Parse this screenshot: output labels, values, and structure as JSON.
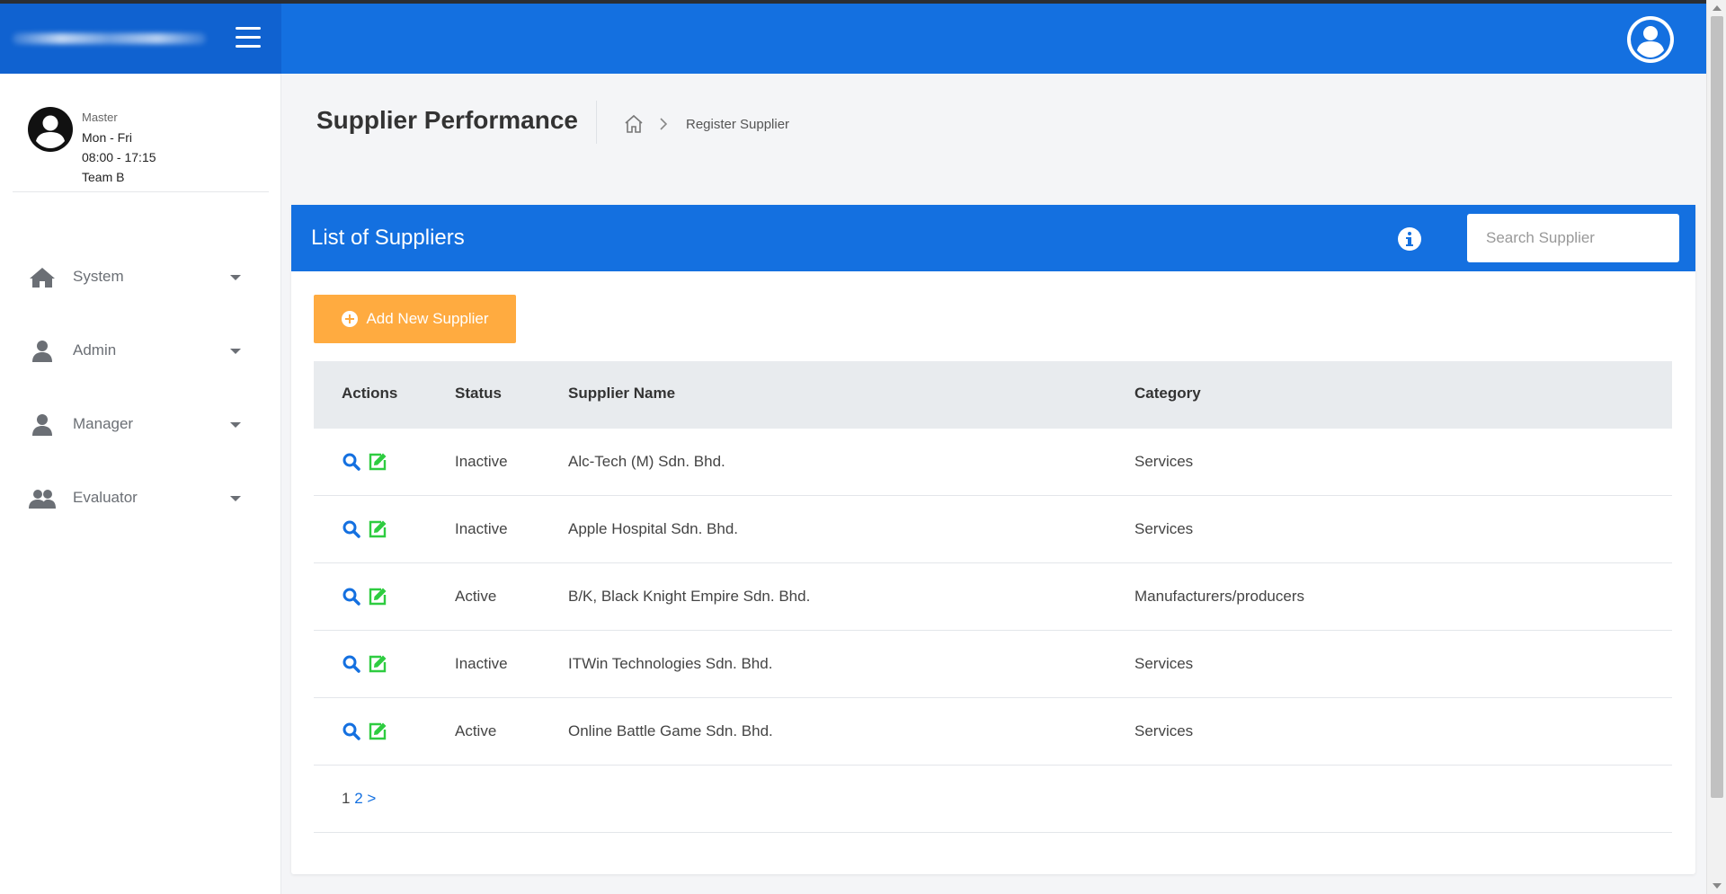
{
  "sidebar": {
    "profile": {
      "role": "Master",
      "days": "Mon - Fri",
      "hours": "08:00 - 17:15",
      "team": "Team B"
    },
    "items": [
      {
        "label": "System",
        "icon": "home-icon"
      },
      {
        "label": "Admin",
        "icon": "user-icon"
      },
      {
        "label": "Manager",
        "icon": "user-icon"
      },
      {
        "label": "Evaluator",
        "icon": "users-icon"
      }
    ]
  },
  "page": {
    "title": "Supplier Performance",
    "breadcrumb_current": "Register Supplier"
  },
  "card": {
    "title": "List of Suppliers",
    "search_placeholder": "Search Supplier",
    "add_button": "Add New Supplier"
  },
  "table": {
    "headers": {
      "actions": "Actions",
      "status": "Status",
      "name": "Supplier Name",
      "category": "Category"
    },
    "rows": [
      {
        "status": "Inactive",
        "name": "Alc-Tech (M) Sdn. Bhd.",
        "category": "Services"
      },
      {
        "status": "Inactive",
        "name": "Apple Hospital Sdn. Bhd.",
        "category": "Services"
      },
      {
        "status": "Active",
        "name": "B/K, Black Knight Empire Sdn. Bhd.",
        "category": "Manufacturers/producers"
      },
      {
        "status": "Inactive",
        "name": "ITWin Technologies Sdn. Bhd.",
        "category": "Services"
      },
      {
        "status": "Active",
        "name": "Online Battle Game Sdn. Bhd.",
        "category": "Services"
      }
    ]
  },
  "pagination": {
    "page1": "1",
    "page2": "2",
    "next": ">"
  },
  "colors": {
    "header_blue": "#1470e0",
    "brand_blue": "#1062d0",
    "add_button": "#ffab40",
    "search_action": "#1470e0",
    "edit_action": "#2ecc40"
  }
}
